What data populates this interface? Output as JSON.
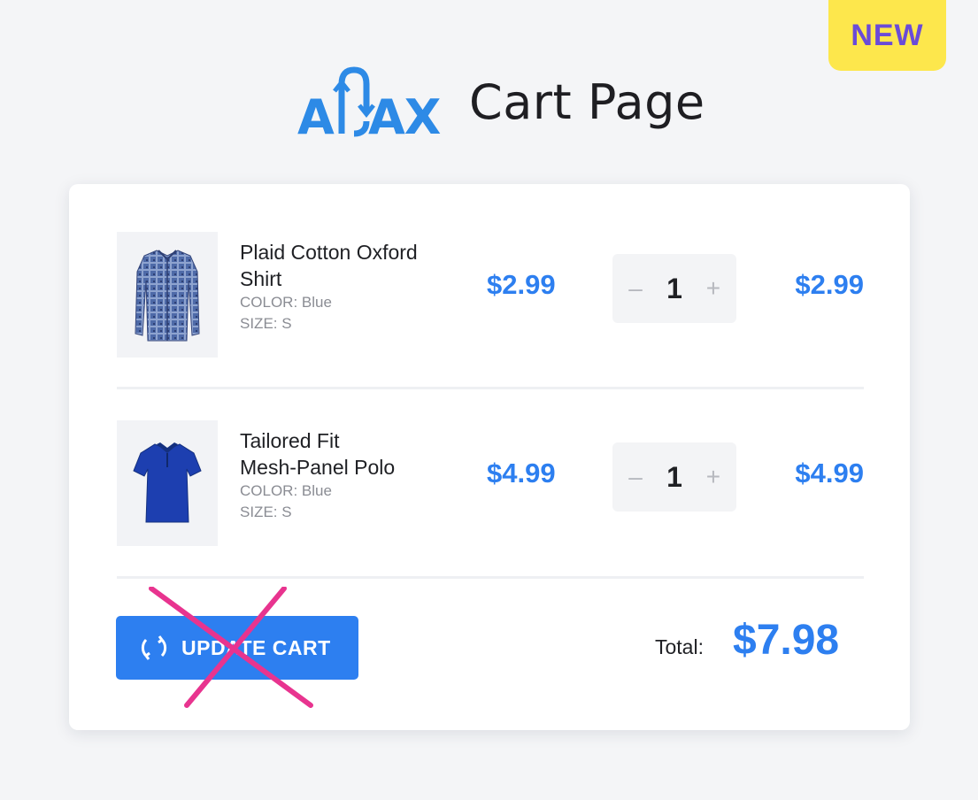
{
  "badge": "NEW",
  "header": {
    "logo_text": "AJAX",
    "title": "Cart Page"
  },
  "cart": {
    "items": [
      {
        "name_line1": "Plaid Cotton Oxford",
        "name_line2": "Shirt",
        "color": "COLOR: Blue",
        "size": "SIZE: S",
        "price": "$2.99",
        "quantity": "1",
        "subtotal": "$2.99",
        "icon": "plaid-shirt-icon"
      },
      {
        "name_line1": "Tailored Fit",
        "name_line2": "Mesh-Panel Polo",
        "color": "COLOR: Blue",
        "size": "SIZE: S",
        "price": "$4.99",
        "quantity": "1",
        "subtotal": "$4.99",
        "icon": "polo-shirt-icon"
      }
    ],
    "qty_minus": "–",
    "qty_plus": "+",
    "update_button": "UPDATE CART",
    "total_label": "Total:",
    "total_value": "$7.98"
  },
  "colors": {
    "accent": "#2d7ff0",
    "badge_bg": "#fde74c",
    "badge_text": "#6a4bd8",
    "strike": "#e8348f"
  }
}
